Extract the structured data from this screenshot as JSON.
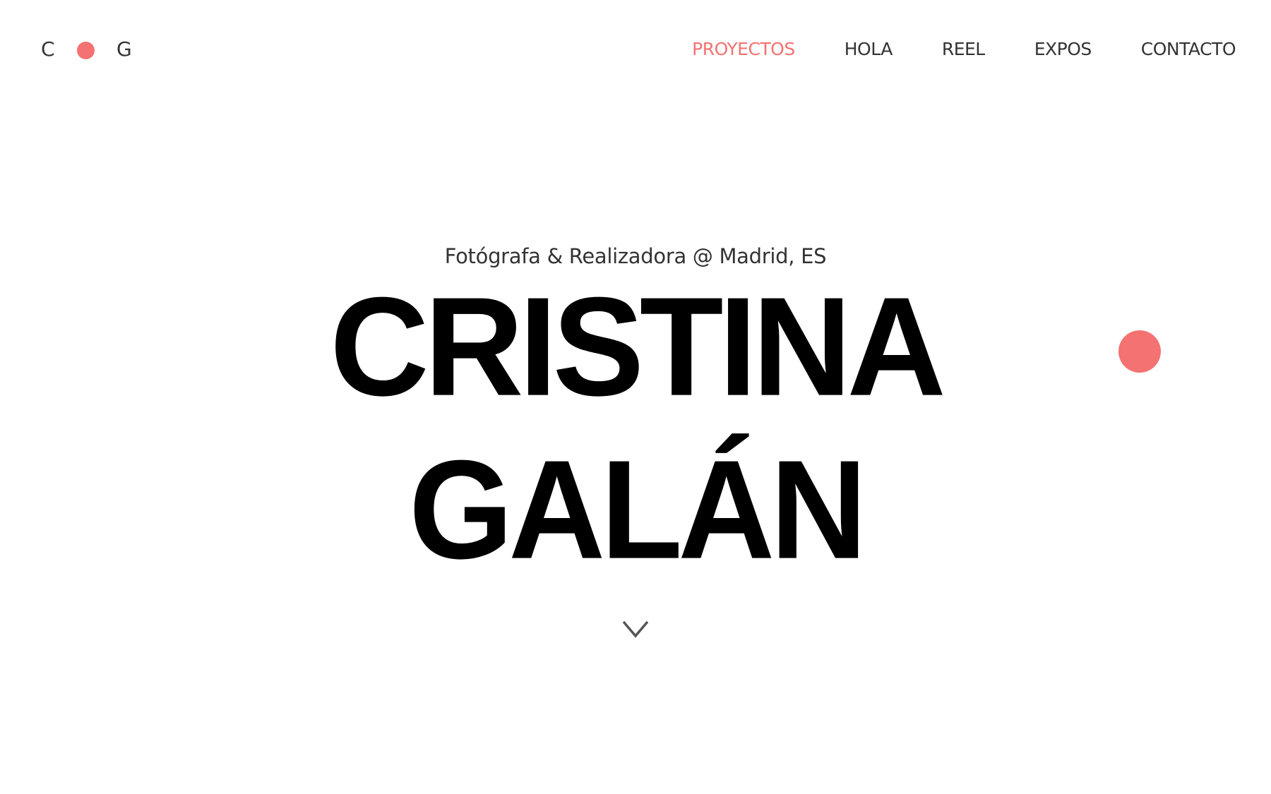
{
  "logo": {
    "left_letter": "C",
    "right_letter": "G"
  },
  "nav": {
    "items": [
      {
        "label": "PROYECTOS",
        "active": true
      },
      {
        "label": "HOLA",
        "active": false
      },
      {
        "label": "REEL",
        "active": false
      },
      {
        "label": "EXPOS",
        "active": false
      },
      {
        "label": "CONTACTO",
        "active": false
      }
    ]
  },
  "hero": {
    "subtitle": "Fotógrafa & Realizadora @ Madrid, ES",
    "first_name": "CRISTINA",
    "last_name": "GALÁN"
  },
  "icons": {
    "scroll": "chevron-down-icon"
  },
  "colors": {
    "accent": "#f47272",
    "text": "#333333",
    "heading": "#000000",
    "background": "#ffffff"
  }
}
